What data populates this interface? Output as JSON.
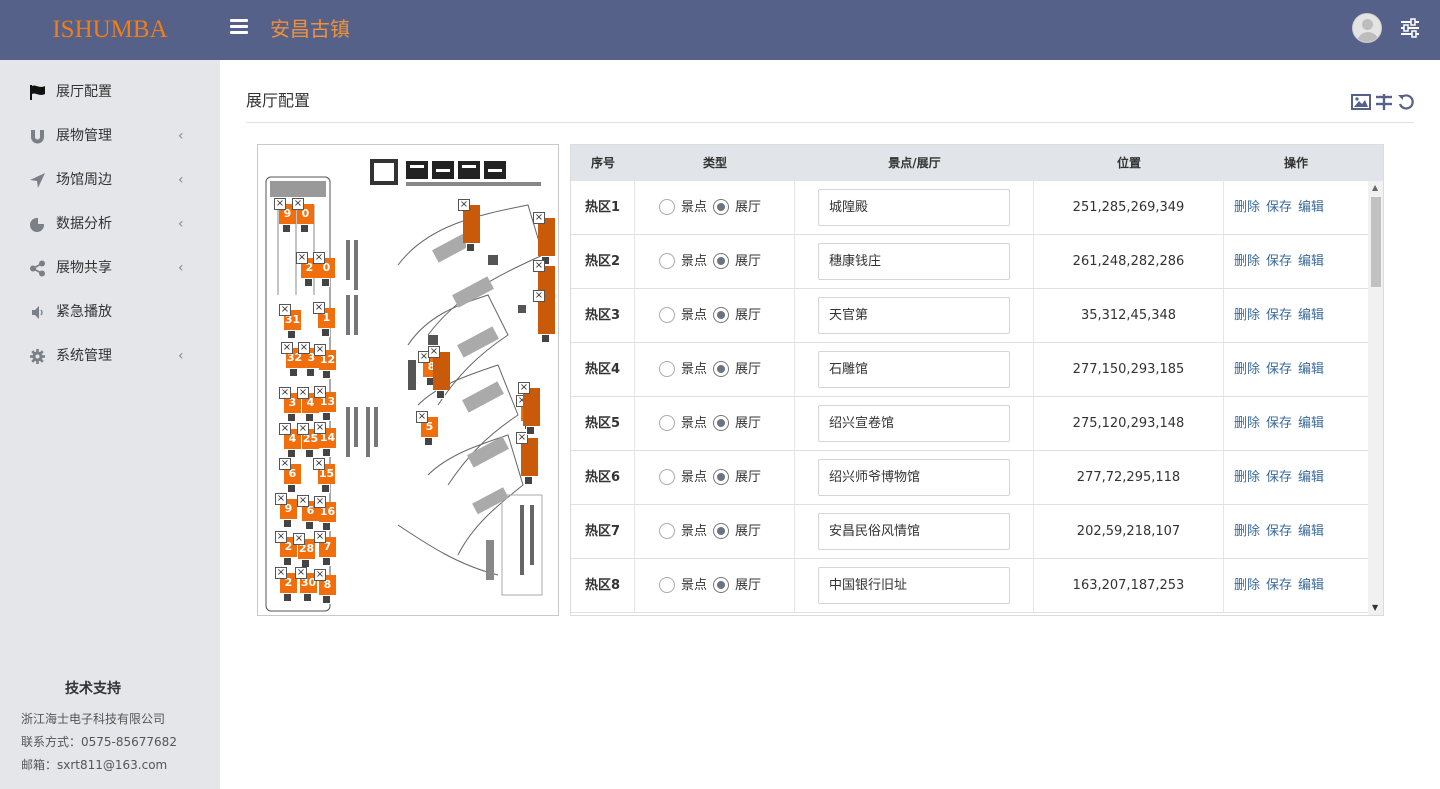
{
  "header": {
    "logo": "ISHUMBA",
    "title": "安昌古镇"
  },
  "sidebar": {
    "items": [
      {
        "label": "展厅配置",
        "icon": "flag-icon",
        "has_submenu": false
      },
      {
        "label": "展物管理",
        "icon": "magnet-icon",
        "has_submenu": true
      },
      {
        "label": "场馆周边",
        "icon": "location-arrow-icon",
        "has_submenu": true
      },
      {
        "label": "数据分析",
        "icon": "pie-chart-icon",
        "has_submenu": true
      },
      {
        "label": "展物共享",
        "icon": "share-icon",
        "has_submenu": true
      },
      {
        "label": "紧急播放",
        "icon": "volume-icon",
        "has_submenu": false
      },
      {
        "label": "系统管理",
        "icon": "gear-icon",
        "has_submenu": true
      }
    ],
    "support": {
      "title": "技术支持",
      "company": "浙江海士电子科技有限公司",
      "contact": "联系方式：0575-85677682",
      "email": "邮箱：sxrt811@163.com"
    }
  },
  "page": {
    "title": "展厅配置"
  },
  "map": {
    "hotspots": [
      "9",
      "0",
      "2",
      "0",
      "31",
      "1",
      "32",
      "3",
      "12",
      "3",
      "4",
      "13",
      "4",
      "25",
      "14",
      "6",
      "15",
      "9",
      "6",
      "16",
      "2",
      "28",
      "7",
      "2",
      "30",
      "8",
      "8",
      "5",
      "2"
    ]
  },
  "table": {
    "columns": [
      "序号",
      "类型",
      "景点/展厅",
      "位置",
      "操作"
    ],
    "radio_options": [
      "景点",
      "展厅"
    ],
    "actions": [
      "删除",
      "保存",
      "编辑"
    ],
    "rows": [
      {
        "seq": "热区1",
        "type": "展厅",
        "name": "城隍殿",
        "position": "251,285,269,349"
      },
      {
        "seq": "热区2",
        "type": "展厅",
        "name": "穗康钱庄",
        "position": "261,248,282,286"
      },
      {
        "seq": "热区3",
        "type": "展厅",
        "name": "天官第",
        "position": "35,312,45,348"
      },
      {
        "seq": "热区4",
        "type": "展厅",
        "name": "石雕馆",
        "position": "277,150,293,185"
      },
      {
        "seq": "热区5",
        "type": "展厅",
        "name": "绍兴宣卷馆",
        "position": "275,120,293,148"
      },
      {
        "seq": "热区6",
        "type": "展厅",
        "name": "绍兴师爷博物馆",
        "position": "277,72,295,118"
      },
      {
        "seq": "热区7",
        "type": "展厅",
        "name": "安昌民俗风情馆",
        "position": "202,59,218,107"
      },
      {
        "seq": "热区8",
        "type": "展厅",
        "name": "中国银行旧址",
        "position": "163,207,187,253"
      }
    ]
  },
  "colors": {
    "header_bg": "#556189",
    "logo": "#f07d1a",
    "sidebar_bg": "#e4e6ea",
    "hotspot": "#f06f0c",
    "link": "#3a6a9a"
  }
}
